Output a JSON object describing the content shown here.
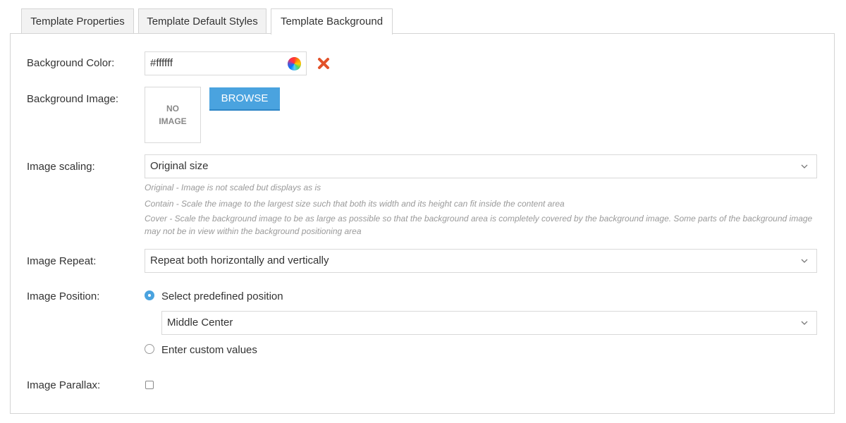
{
  "tabs": [
    {
      "label": "Template Properties"
    },
    {
      "label": "Template Default Styles"
    },
    {
      "label": "Template Background"
    }
  ],
  "background_color": {
    "label": "Background Color:",
    "value": "#ffffff",
    "picker_icon": "color-wheel-icon",
    "clear_icon": "red-x-icon"
  },
  "background_image": {
    "label": "Background Image:",
    "placeholder_line1": "NO",
    "placeholder_line2": "IMAGE",
    "browse_label": "BROWSE"
  },
  "image_scaling": {
    "label": "Image scaling:",
    "selected": "Original size",
    "hints": [
      "Original - Image is not scaled but displays as is",
      "Contain - Scale the image to the largest size such that both its width and its height can fit inside the content area",
      "Cover - Scale the background image to be as large as possible so that the background area is completely covered by the background image. Some parts of the background image",
      "may not be in view within the background positioning area"
    ]
  },
  "image_repeat": {
    "label": "Image Repeat:",
    "selected": "Repeat both horizontally and vertically"
  },
  "image_position": {
    "label": "Image Position:",
    "option_predefined": "Select predefined position",
    "predefined_selected": "Middle Center",
    "option_custom": "Enter custom values",
    "selected_option": "predefined"
  },
  "image_parallax": {
    "label": "Image Parallax:",
    "checked": false
  },
  "colors": {
    "accent": "#4aa3df",
    "border": "#d4d4d4",
    "hint": "#9a9a9a",
    "clear_icon": "#e2522a"
  }
}
